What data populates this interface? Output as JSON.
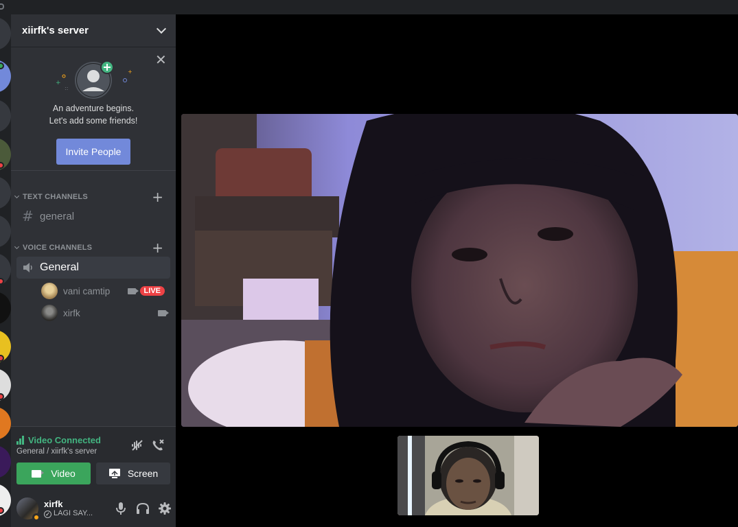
{
  "server": {
    "name": "xiirfk's server"
  },
  "invite": {
    "line1": "An adventure begins.",
    "line2": "Let's add some friends!",
    "button_label": "Invite People"
  },
  "categories": {
    "text": "TEXT CHANNELS",
    "voice": "VOICE CHANNELS"
  },
  "text_channels": [
    {
      "name": "general",
      "icon": "hash-icon"
    }
  ],
  "voice_channels": [
    {
      "name": "General",
      "icon": "speaker-icon",
      "users": [
        {
          "name": "vani camtip",
          "video": true,
          "live": true,
          "live_label": "LIVE"
        },
        {
          "name": "xirfk",
          "video": true,
          "live": false
        }
      ]
    }
  ],
  "rtc": {
    "status": "Video Connected",
    "subtitle": "General / xiirfk's server",
    "video_label": "Video",
    "screen_label": "Screen"
  },
  "user": {
    "name": "xirfk",
    "status_text": "LAGI SAY..."
  },
  "colors": {
    "accent": "#7289da",
    "connected_green": "#43b581",
    "video_button": "#3ba55c",
    "live_red": "#ed4245",
    "idle_status": "#faa61a"
  }
}
